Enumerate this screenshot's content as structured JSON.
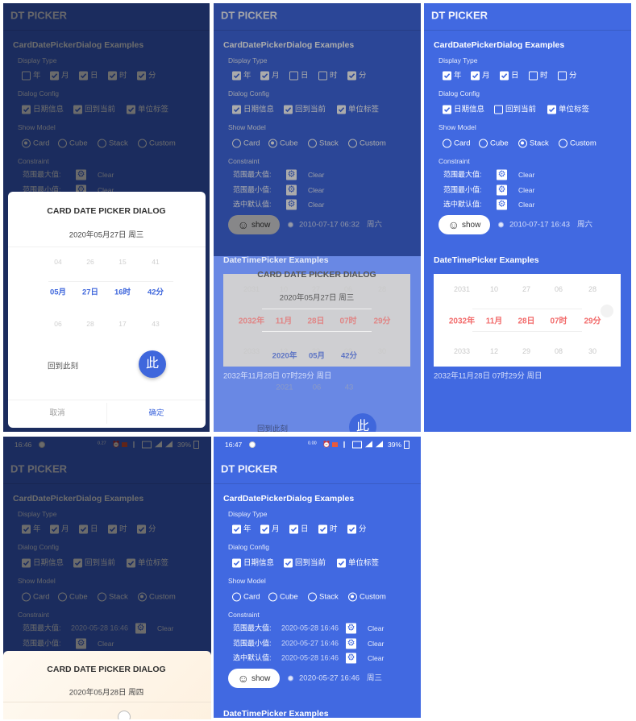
{
  "colors": {
    "primary": "#4169e1",
    "picker_selected": "#f26a6a",
    "dialog_accent": "#3f67dc"
  },
  "panels": [
    {
      "title": "DT PICKER",
      "section1": "CardDatePickerDialog Examples",
      "display_type": {
        "label": "Display Type",
        "items": [
          {
            "label": "年",
            "checked": false
          },
          {
            "label": "月",
            "checked": true
          },
          {
            "label": "日",
            "checked": true
          },
          {
            "label": "时",
            "checked": true
          },
          {
            "label": "分",
            "checked": true
          }
        ]
      },
      "dialog_config": {
        "label": "Dialog Config",
        "items": [
          {
            "label": "日期信息",
            "checked": true
          },
          {
            "label": "回到当前",
            "checked": true
          },
          {
            "label": "单位标签",
            "checked": true
          }
        ]
      },
      "show_model": {
        "label": "Show Model",
        "options": [
          "Card",
          "Cube",
          "Stack",
          "Custom"
        ],
        "selected": "Card"
      },
      "constraint": {
        "label": "Constraint",
        "rows": [
          {
            "label": "范围最大值:",
            "value": "",
            "clear": "Clear",
            "icon": "gear-icon"
          },
          {
            "label": "范围最小值:",
            "value": "",
            "clear": "Clear",
            "icon": "gear-icon"
          }
        ]
      },
      "dialog": {
        "title": "CARD DATE PICKER DIALOG",
        "date": "2020年05月27日 周三",
        "wheel": [
          [
            "04",
            "26",
            "15",
            "41"
          ],
          [
            "05月",
            "27日",
            "16时",
            "42分"
          ],
          [
            "06",
            "28",
            "17",
            "43"
          ]
        ],
        "now_label": "回到此刻",
        "now_button": "此",
        "cancel": "取消",
        "confirm": "确定"
      }
    },
    {
      "title": "DT PICKER",
      "section1": "CardDatePickerDialog Examples",
      "display_type": {
        "label": "Display Type",
        "items": [
          {
            "label": "年",
            "checked": true
          },
          {
            "label": "月",
            "checked": true
          },
          {
            "label": "日",
            "checked": false
          },
          {
            "label": "时",
            "checked": false
          },
          {
            "label": "分",
            "checked": true
          }
        ]
      },
      "dialog_config": {
        "label": "Dialog Config",
        "items": [
          {
            "label": "日期信息",
            "checked": true
          },
          {
            "label": "回到当前",
            "checked": true
          },
          {
            "label": "单位标签",
            "checked": true
          }
        ]
      },
      "show_model": {
        "label": "Show Model",
        "options": [
          "Card",
          "Cube",
          "Stack",
          "Custom"
        ],
        "selected": "Cube"
      },
      "constraint": {
        "label": "Constraint",
        "rows": [
          {
            "label": "范围最大值:",
            "value": "",
            "clear": "Clear",
            "icon": "gear-icon"
          },
          {
            "label": "范围最小值:",
            "value": "",
            "clear": "Clear",
            "icon": "gear-icon"
          },
          {
            "label": "选中默认值:",
            "value": "",
            "clear": "Clear",
            "icon": "gear-icon"
          }
        ]
      },
      "show_button": "show",
      "result": {
        "datetime": "2010-07-17 06:32",
        "weekday": "周六"
      },
      "section2": "DateTimePicker Examples",
      "picker": {
        "rows": [
          [
            "2031",
            "10",
            "27",
            "06",
            "28"
          ],
          [
            "2032年",
            "11月",
            "28日",
            "07时",
            "29分"
          ],
          [
            "2033",
            "12",
            "29",
            "08",
            "30"
          ]
        ]
      },
      "picker_result": "2032年11月28日 07时29分  周日",
      "ghost_dialog": {
        "title": "CARD DATE PICKER DIALOG",
        "date": "2020年05月27日 周三",
        "wheel": [
          [
            "2020年",
            "05月",
            "42分"
          ],
          [
            "2021",
            "06",
            "43"
          ]
        ],
        "now_label": "回到此刻",
        "now_button": "此"
      }
    },
    {
      "title": "DT PICKER",
      "section1": "CardDatePickerDialog Examples",
      "display_type": {
        "label": "Display Type",
        "items": [
          {
            "label": "年",
            "checked": true
          },
          {
            "label": "月",
            "checked": true
          },
          {
            "label": "日",
            "checked": true
          },
          {
            "label": "时",
            "checked": false
          },
          {
            "label": "分",
            "checked": false
          }
        ]
      },
      "dialog_config": {
        "label": "Dialog Config",
        "items": [
          {
            "label": "日期信息",
            "checked": true
          },
          {
            "label": "回到当前",
            "checked": false
          },
          {
            "label": "单位标签",
            "checked": true
          }
        ]
      },
      "show_model": {
        "label": "Show Model",
        "options": [
          "Card",
          "Cube",
          "Stack",
          "Custom"
        ],
        "selected": "Stack"
      },
      "constraint": {
        "label": "Constraint",
        "rows": [
          {
            "label": "范围最大值:",
            "value": "",
            "clear": "Clear",
            "icon": "gear-icon"
          },
          {
            "label": "范围最小值:",
            "value": "",
            "clear": "Clear",
            "icon": "gear-icon"
          },
          {
            "label": "选中默认值:",
            "value": "",
            "clear": "Clear",
            "icon": "gear-icon"
          }
        ]
      },
      "show_button": "show",
      "result": {
        "datetime": "2010-07-17 16:43",
        "weekday": "周六"
      },
      "section2": "DateTimePicker Examples",
      "picker": {
        "rows": [
          [
            "2031",
            "10",
            "27",
            "06",
            "28"
          ],
          [
            "2032年",
            "11月",
            "28日",
            "07时",
            "29分"
          ],
          [
            "2033",
            "12",
            "29",
            "08",
            "30"
          ]
        ]
      },
      "picker_result": "2032年11月28日 07时29分  周日"
    },
    {
      "status": {
        "time": "16:46",
        "net_speed": "0.27",
        "battery": "39%"
      },
      "title": "DT PICKER",
      "section1": "CardDatePickerDialog Examples",
      "display_type": {
        "label": "Display Type",
        "items": [
          {
            "label": "年",
            "checked": true
          },
          {
            "label": "月",
            "checked": true
          },
          {
            "label": "日",
            "checked": true
          },
          {
            "label": "时",
            "checked": true
          },
          {
            "label": "分",
            "checked": true
          }
        ]
      },
      "dialog_config": {
        "label": "Dialog Config",
        "items": [
          {
            "label": "日期信息",
            "checked": true
          },
          {
            "label": "回到当前",
            "checked": true
          },
          {
            "label": "单位标签",
            "checked": true
          }
        ]
      },
      "show_model": {
        "label": "Show Model",
        "options": [
          "Card",
          "Cube",
          "Stack",
          "Custom"
        ],
        "selected": "Custom"
      },
      "constraint": {
        "label": "Constraint",
        "rows": [
          {
            "label": "范围最大值:",
            "value": "2020-05-28 16:46",
            "clear": "Clear",
            "icon": "gear-icon"
          },
          {
            "label": "范围最小值:",
            "value": "",
            "clear": "Clear",
            "icon": "gear-icon"
          }
        ]
      },
      "dialog": {
        "title": "CARD DATE PICKER DIALOG",
        "date": "2020年05月28日 周四"
      }
    },
    {
      "status": {
        "time": "16:47",
        "net_speed": "0.00",
        "battery": "39%"
      },
      "title": "DT PICKER",
      "section1": "CardDatePickerDialog Examples",
      "display_type": {
        "label": "Display Type",
        "items": [
          {
            "label": "年",
            "checked": true
          },
          {
            "label": "月",
            "checked": true
          },
          {
            "label": "日",
            "checked": true
          },
          {
            "label": "时",
            "checked": true
          },
          {
            "label": "分",
            "checked": true
          }
        ]
      },
      "dialog_config": {
        "label": "Dialog Config",
        "items": [
          {
            "label": "日期信息",
            "checked": true
          },
          {
            "label": "回到当前",
            "checked": true
          },
          {
            "label": "单位标签",
            "checked": true
          }
        ]
      },
      "show_model": {
        "label": "Show Model",
        "options": [
          "Card",
          "Cube",
          "Stack",
          "Custom"
        ],
        "selected": "Custom"
      },
      "constraint": {
        "label": "Constraint",
        "rows": [
          {
            "label": "范围最大值:",
            "value": "2020-05-28 16:46",
            "clear": "Clear",
            "icon": "gear-icon"
          },
          {
            "label": "范围最小值:",
            "value": "2020-05-27 16:46",
            "clear": "Clear",
            "icon": "gear-icon"
          },
          {
            "label": "选中默认值:",
            "value": "2020-05-28 16:46",
            "clear": "Clear",
            "icon": "gear-icon"
          }
        ]
      },
      "show_button": "show",
      "result": {
        "datetime": "2020-05-27 16:46",
        "weekday": "周三"
      },
      "section2": "DateTimePicker Examples"
    }
  ]
}
